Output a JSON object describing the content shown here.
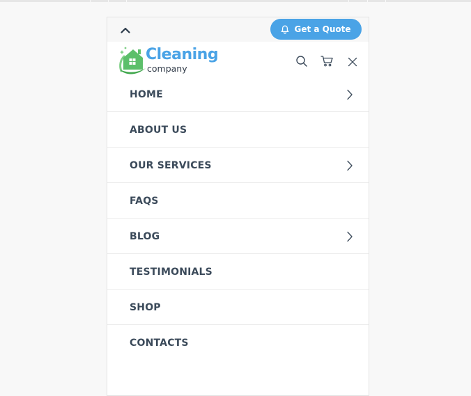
{
  "header": {
    "collapse_icon": "chevron-up-icon",
    "quote_button": {
      "label": "Get a Quote",
      "icon": "bell-icon",
      "color": "#4aa3e6"
    }
  },
  "logo": {
    "brand": "Cleaning",
    "sub": "company",
    "brand_color": "#4aa3e6",
    "mark_color": "#5cbf6a"
  },
  "actions": {
    "search_icon": "search-icon",
    "cart_icon": "cart-icon",
    "close_icon": "close-icon"
  },
  "menu": {
    "items": [
      {
        "label": "HOME",
        "has_submenu": true
      },
      {
        "label": "ABOUT US",
        "has_submenu": false
      },
      {
        "label": "OUR SERVICES",
        "has_submenu": true
      },
      {
        "label": "FAQS",
        "has_submenu": false
      },
      {
        "label": "BLOG",
        "has_submenu": true
      },
      {
        "label": "TESTIMONIALS",
        "has_submenu": false
      },
      {
        "label": "SHOP",
        "has_submenu": false
      },
      {
        "label": "CONTACTS",
        "has_submenu": false
      }
    ]
  }
}
